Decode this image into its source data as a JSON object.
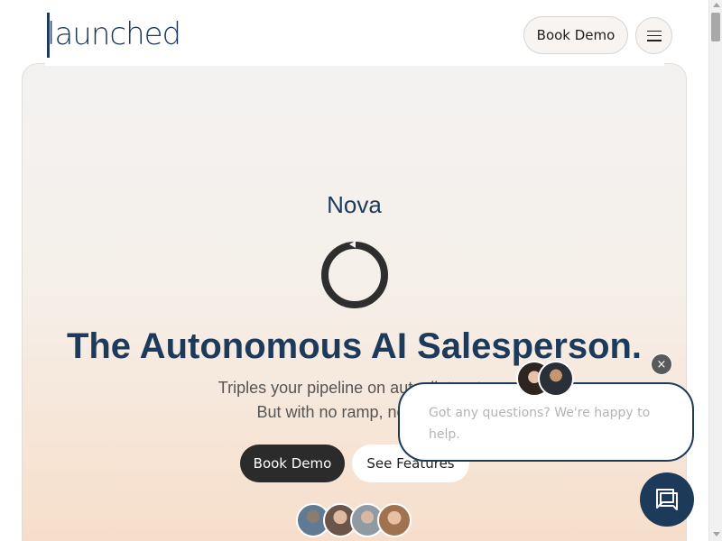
{
  "header": {
    "logo_text": "launched",
    "book_demo_label": "Book Demo",
    "menu_icon": "hamburger-icon"
  },
  "hero": {
    "product_name": "Nova",
    "loading_icon": "spinner-icon",
    "headline": "The Autonomous AI Salesperson.",
    "subline_1": "Triples your pipeline on autopilot — tu",
    "subline_2": "But with no ramp, no burno",
    "primary_cta": "Book Demo",
    "secondary_cta": "See Features"
  },
  "chat": {
    "close_glyph": "×",
    "message": "Got any questions? We're happy to help.",
    "launcher_icon": "chat-bubble-icon"
  },
  "colors": {
    "brand_navy": "#1e3a5a",
    "dark_button": "#2b2b2b"
  }
}
